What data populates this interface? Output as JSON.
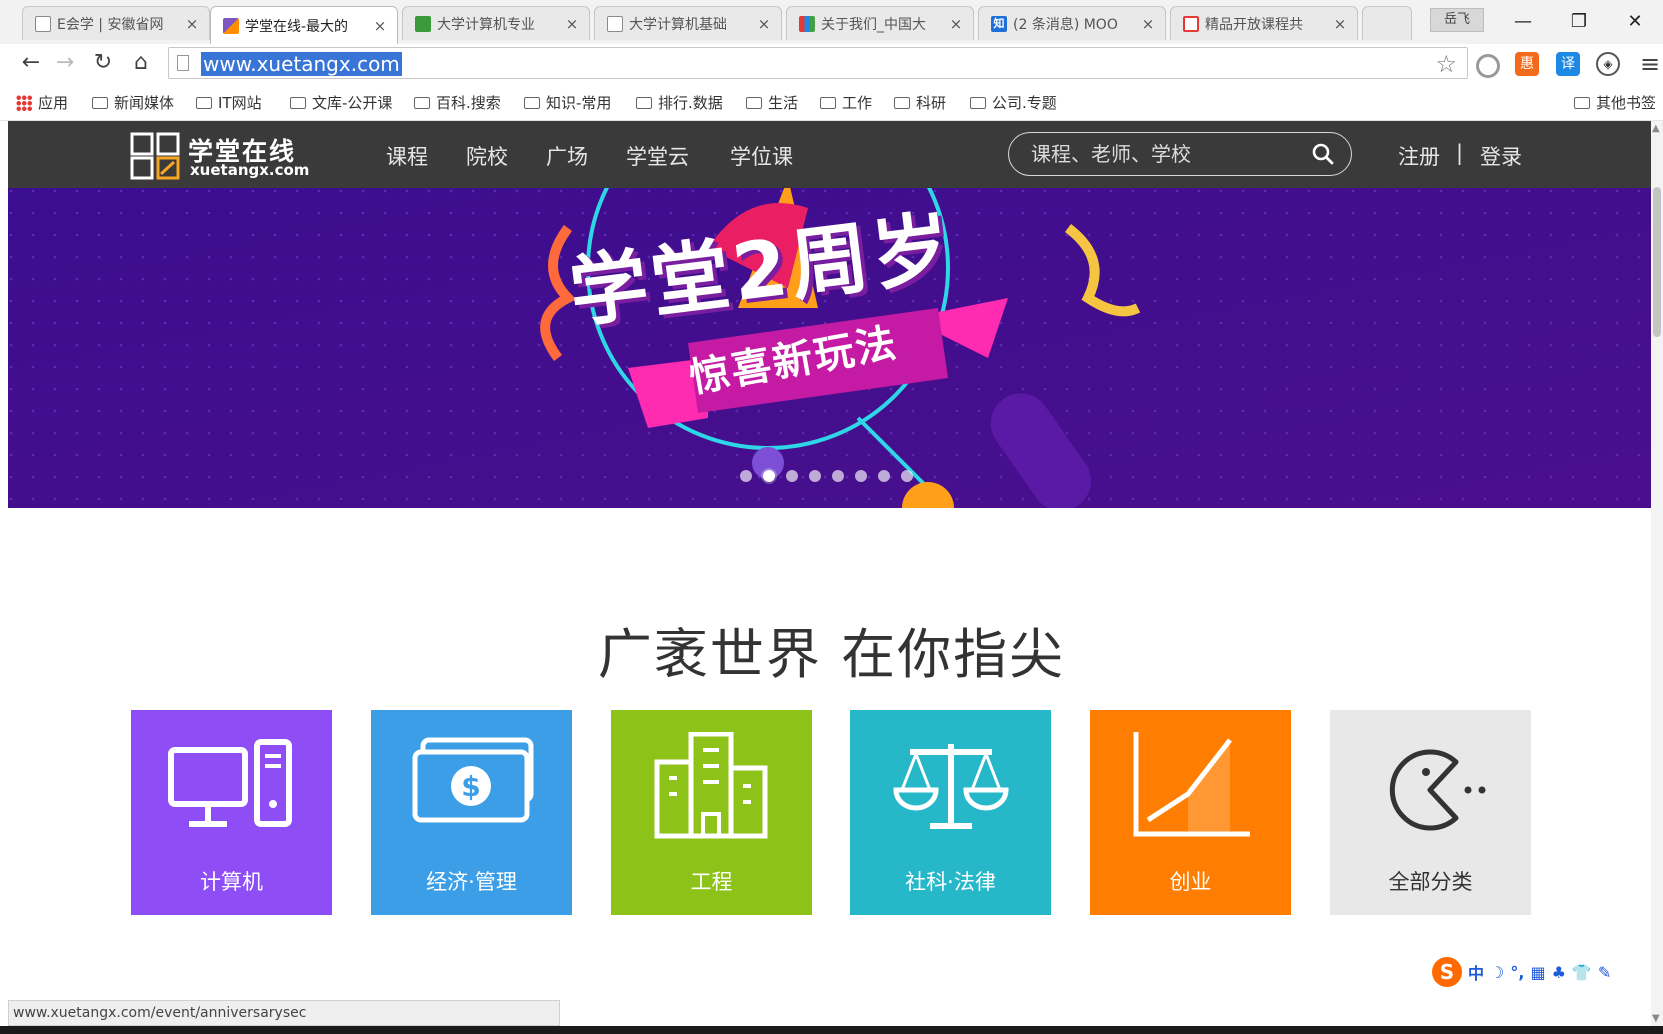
{
  "browser": {
    "tabs": [
      {
        "title": "E会学 | 安徽省网",
        "icon": "doc-icon"
      },
      {
        "title": "学堂在线-最大的",
        "icon": "xuetangx-icon",
        "active": true
      },
      {
        "title": "大学计算机专业",
        "icon": "green-book-icon"
      },
      {
        "title": "大学计算机基础",
        "icon": "doc-icon"
      },
      {
        "title": "关于我们_中国大",
        "icon": "flag-icon"
      },
      {
        "title": "(2 条消息) MOO",
        "icon": "zhihu-icon"
      },
      {
        "title": "精品开放课程共",
        "icon": "star-icon"
      }
    ],
    "tab_close_glyph": "×",
    "zhihu_glyph": "知",
    "user_chip": "岳飞",
    "window_controls": {
      "min": "—",
      "max": "❐",
      "close": "✕"
    },
    "url": "www.xuetangx.com",
    "ext_hui": "惠",
    "ext_yi": "译",
    "bookmarks": [
      {
        "label": "应用",
        "type": "apps"
      },
      {
        "label": "新闻媒体",
        "type": "folder"
      },
      {
        "label": "IT网站",
        "type": "folder"
      },
      {
        "label": "文库-公开课",
        "type": "folder"
      },
      {
        "label": "百科.搜索",
        "type": "folder"
      },
      {
        "label": "知识-常用",
        "type": "folder"
      },
      {
        "label": "排行.数据",
        "type": "folder"
      },
      {
        "label": "生活",
        "type": "folder"
      },
      {
        "label": "工作",
        "type": "folder"
      },
      {
        "label": "科研",
        "type": "folder"
      },
      {
        "label": "公司.专题",
        "type": "folder"
      }
    ],
    "other_bookmarks": "其他书签",
    "status_url": "www.xuetangx.com/event/anniversarysec"
  },
  "site": {
    "logo_cn": "学堂在线",
    "logo_en": "xuetangx.com",
    "nav": [
      "课程",
      "院校",
      "广场",
      "学堂云",
      "学位课"
    ],
    "search_placeholder": "课程、老师、学校",
    "register": "注册",
    "auth_sep": "|",
    "login": "登录",
    "banner": {
      "title": "学堂2周岁",
      "subtitle": "惊喜新玩法",
      "slide_count": 8,
      "active_slide": 1
    },
    "slogan": "广袤世界  在你指尖",
    "categories": [
      {
        "label": "计算机",
        "icon": "computer-icon",
        "color": "#8f4df5"
      },
      {
        "label": "经济·管理",
        "icon": "money-icon",
        "color": "#3b9ee6"
      },
      {
        "label": "工程",
        "icon": "building-icon",
        "color": "#8dc218"
      },
      {
        "label": "社科·法律",
        "icon": "scales-icon",
        "color": "#26b8c9"
      },
      {
        "label": "创业",
        "icon": "growth-chart-icon",
        "color": "#ff7d00"
      },
      {
        "label": "全部分类",
        "icon": "pacman-icon",
        "color": "#e8e8e8"
      }
    ]
  },
  "ime": {
    "mode": "中",
    "items": [
      "中",
      "☽",
      "°,",
      "▦",
      "♣",
      "👕",
      "✎"
    ]
  }
}
